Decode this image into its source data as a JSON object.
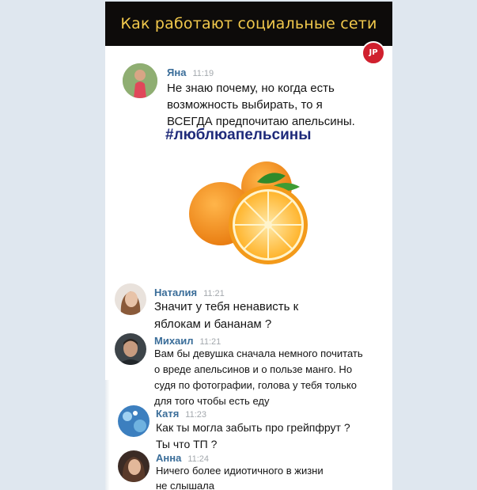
{
  "banner": {
    "title": "Как работают социальные сети",
    "badge": "JP"
  },
  "post": {
    "author": "Яна",
    "time": "11:19",
    "lines": [
      "Не знаю почему, но когда есть",
      "возможность выбирать, то я",
      "ВСЕГДА предпочитаю апельсины."
    ],
    "hashtag": "#люблюапельсины"
  },
  "comments": [
    {
      "author": "Наталия",
      "time": "11:21",
      "lines": [
        "Значит у тебя ненависть к",
        "яблокам и бананам ?"
      ]
    },
    {
      "author": "Михаил",
      "time": "11:21",
      "lines": [
        "Вам бы девушка сначала немного почитать",
        "о вреде апельсинов и о пользе манго. Но",
        "судя по фотографии, голова у тебя только",
        "для того чтобы есть еду"
      ]
    },
    {
      "author": "Катя",
      "time": "11:23",
      "lines": [
        "Как ты могла забыть про грейпфрут ?",
        "Ты что ТП ?"
      ]
    },
    {
      "author": "Анна",
      "time": "11:24",
      "lines": [
        "Ничего более идиотичного в жизни",
        "не слышала"
      ]
    }
  ],
  "colors": {
    "banner_bg": "#0d0b0a",
    "banner_text": "#f2c94c",
    "name": "#3a6d99",
    "hashtag": "#1e2a7a",
    "badge": "#d0202e"
  }
}
